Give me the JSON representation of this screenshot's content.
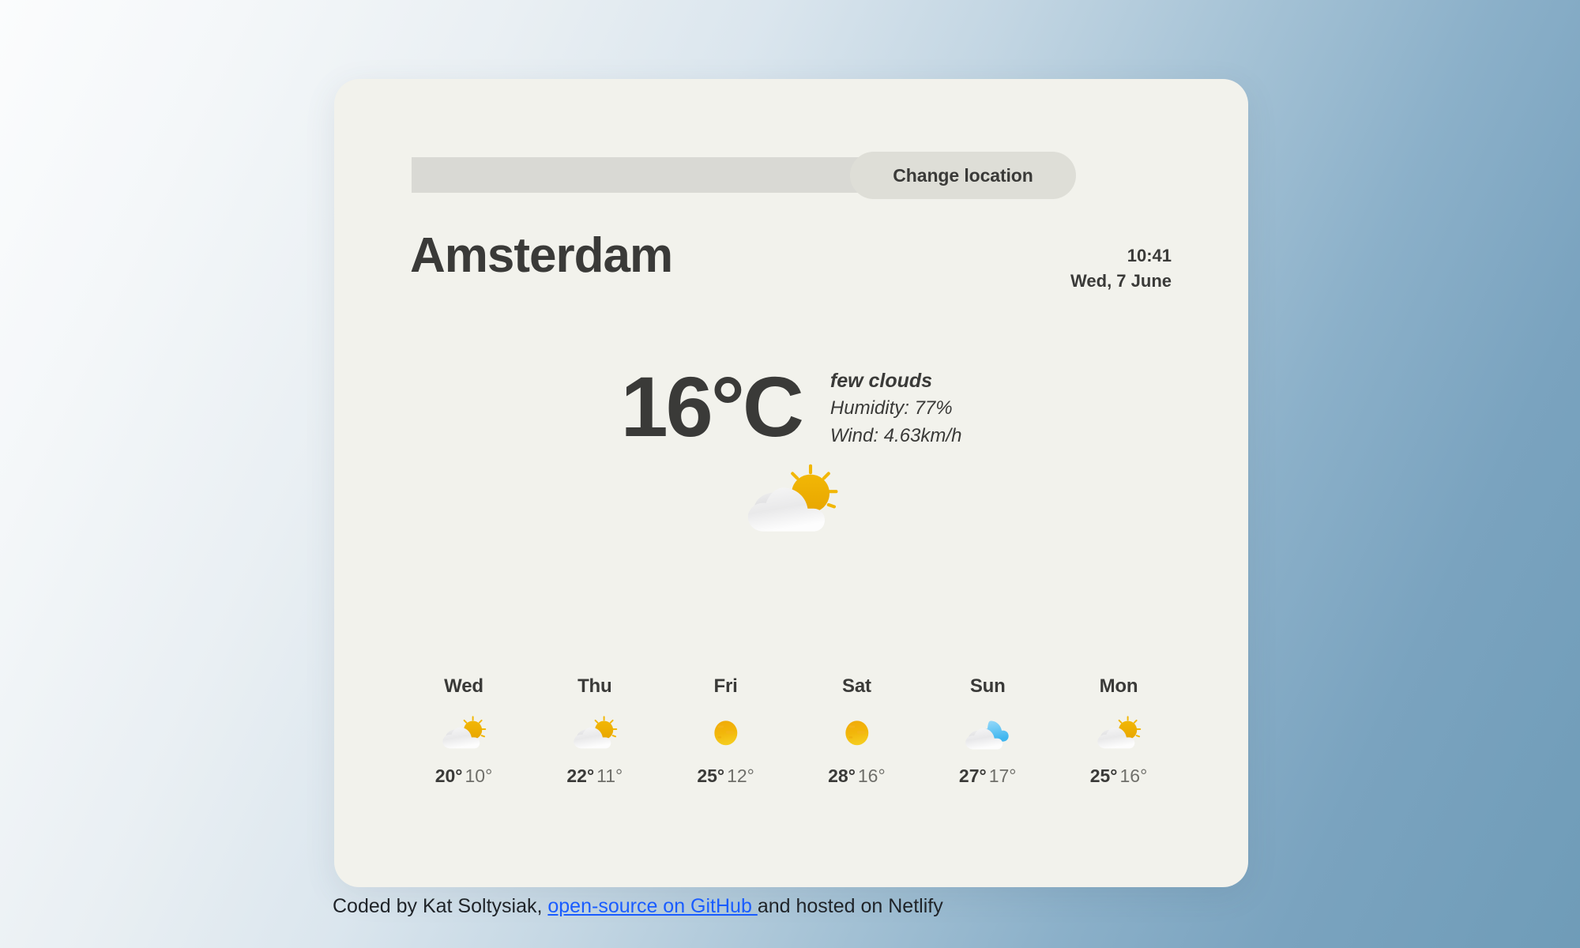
{
  "app": {
    "background_from": "#fbfcfd",
    "background_to": "#6f9cb8",
    "card_color": "#f2f2ec",
    "text_color": "#3a3a38",
    "link_color": "#1a5cff"
  },
  "search": {
    "value": "",
    "placeholder": "",
    "change_location_label": "Change location"
  },
  "location": {
    "city": "Amsterdam",
    "time": "10:41",
    "date": "Wed, 7 June"
  },
  "current": {
    "temperature": "16°C",
    "condition": "few clouds",
    "humidity": "Humidity: 77%",
    "wind": "Wind: 4.63km/h",
    "icon": "sun-behind-cloud-icon"
  },
  "forecast": [
    {
      "day": "Wed",
      "icon": "sun-behind-cloud-icon",
      "max": "20°",
      "min": "10°"
    },
    {
      "day": "Thu",
      "icon": "sun-behind-cloud-icon",
      "max": "22°",
      "min": "11°"
    },
    {
      "day": "Fri",
      "icon": "sun-icon",
      "max": "25°",
      "min": "12°"
    },
    {
      "day": "Sat",
      "icon": "sun-icon",
      "max": "28°",
      "min": "16°"
    },
    {
      "day": "Sun",
      "icon": "broken-clouds-icon",
      "max": "27°",
      "min": "17°"
    },
    {
      "day": "Mon",
      "icon": "sun-behind-cloud-icon",
      "max": "25°",
      "min": "16°"
    }
  ],
  "footer": {
    "prefix": "Coded by Kat Soltysiak, ",
    "link": "open-source on GitHub ",
    "suffix": "and hosted on Netlify"
  }
}
